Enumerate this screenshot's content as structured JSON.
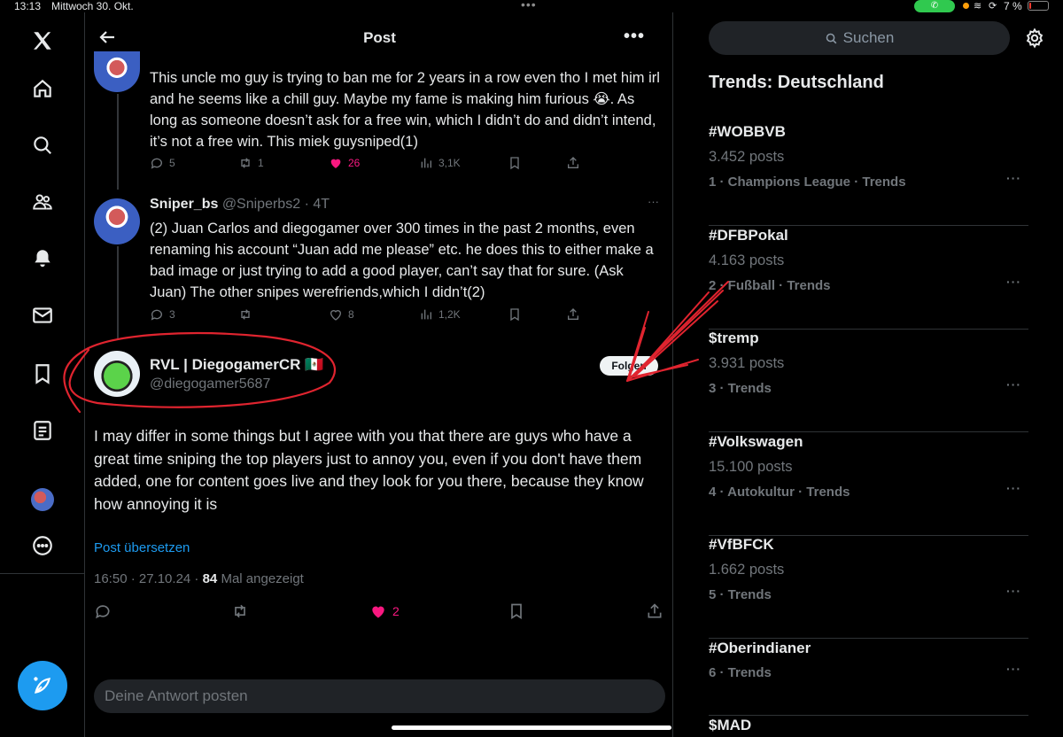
{
  "status_bar": {
    "time": "13:13",
    "date": "Mittwoch 30. Okt.",
    "battery": "7 %"
  },
  "nav": {
    "items": [
      "x-logo",
      "home",
      "explore",
      "communities",
      "notifications",
      "messages",
      "bookmarks",
      "lists",
      "profile",
      "more"
    ],
    "accent": "#1d9bf0"
  },
  "header": {
    "title": "Post"
  },
  "thread": [
    {
      "text": "This uncle mo guy is trying to ban me for 2 years in a row even tho I met him irl and he seems like a chill guy. Maybe my fame is making him furious 😭. As long as someone doesn’t ask for a free win, which I didn’t do and didn’t intend, it’s not a free win. This miek guysniped(1)",
      "replies": "5",
      "reposts": "1",
      "likes": "26",
      "views": "3,1K"
    },
    {
      "name": "Sniper_bs",
      "handle": "@Sniperbs2",
      "time": "· 4T",
      "text": "(2) Juan Carlos and diegogamer over 300 times in the past 2 months, even renaming his account “Juan add me please” etc. he does this to either make a bad image or just trying to add a good player, can’t say that for sure. (Ask Juan) The other snipes werefriends,which I didn’t(2)",
      "replies": "3",
      "likes": "8",
      "views": "1,2K"
    }
  ],
  "main_post": {
    "name": "RVL | DiegogamerCR",
    "flag": "🇲🇽",
    "handle": "@diegogamer5687",
    "follow_label": "Folgen",
    "text": "I may differ in some things but I agree with you that there are guys who have a great time sniping the top players just to annoy you, even if you don't have them added, one for content goes live and they look for you there, because they know how annoying it is",
    "translate": "Post übersetzen",
    "timestamp": "16:50 · 27.10.24 ·",
    "views_count": "84",
    "views_label": "Mal angezeigt",
    "likes": "2"
  },
  "reply": {
    "placeholder": "Deine Antwort posten"
  },
  "search": {
    "placeholder": "Suchen"
  },
  "trends": {
    "title": "Trends: Deutschland",
    "items": [
      {
        "tag": "#WOBBVB",
        "posts": "3.452 posts",
        "category": "1 · Champions League · Trends"
      },
      {
        "tag": "#DFBPokal",
        "posts": "4.163 posts",
        "category": "2 · Fußball · Trends"
      },
      {
        "tag": "$tremp",
        "posts": "3.931 posts",
        "category": "3 · Trends"
      },
      {
        "tag": "#Volkswagen",
        "posts": "15.100 posts",
        "category": "4 · Autokultur · Trends"
      },
      {
        "tag": "#VfBFCK",
        "posts": "1.662 posts",
        "category": "5 · Trends"
      },
      {
        "tag": "#Oberindianer",
        "posts": "",
        "category": "6 · Trends"
      },
      {
        "tag": "$MAD",
        "posts": "",
        "category": ""
      }
    ]
  },
  "colors": {
    "background": "#000000",
    "text": "#e7e9ea",
    "muted": "#71767b",
    "like": "#f91880",
    "link": "#1d9bf0",
    "annotation": "#e0242f"
  }
}
